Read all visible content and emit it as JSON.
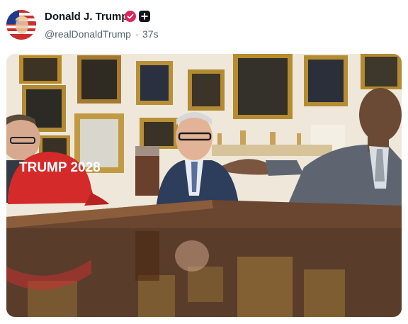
{
  "post": {
    "display_name": "Donald J. Trump",
    "handle": "@realDonaldTrump",
    "separator": "·",
    "timestamp": "37s"
  },
  "icons": {
    "avatar": "flag-portrait-avatar",
    "verified": "verified-badge-icon",
    "follow": "plus-icon"
  },
  "colors": {
    "verified": "#e0245e",
    "text_primary": "#0f1419",
    "text_secondary": "#536471"
  },
  "photo": {
    "hat_text": "TRUMP 2028"
  }
}
